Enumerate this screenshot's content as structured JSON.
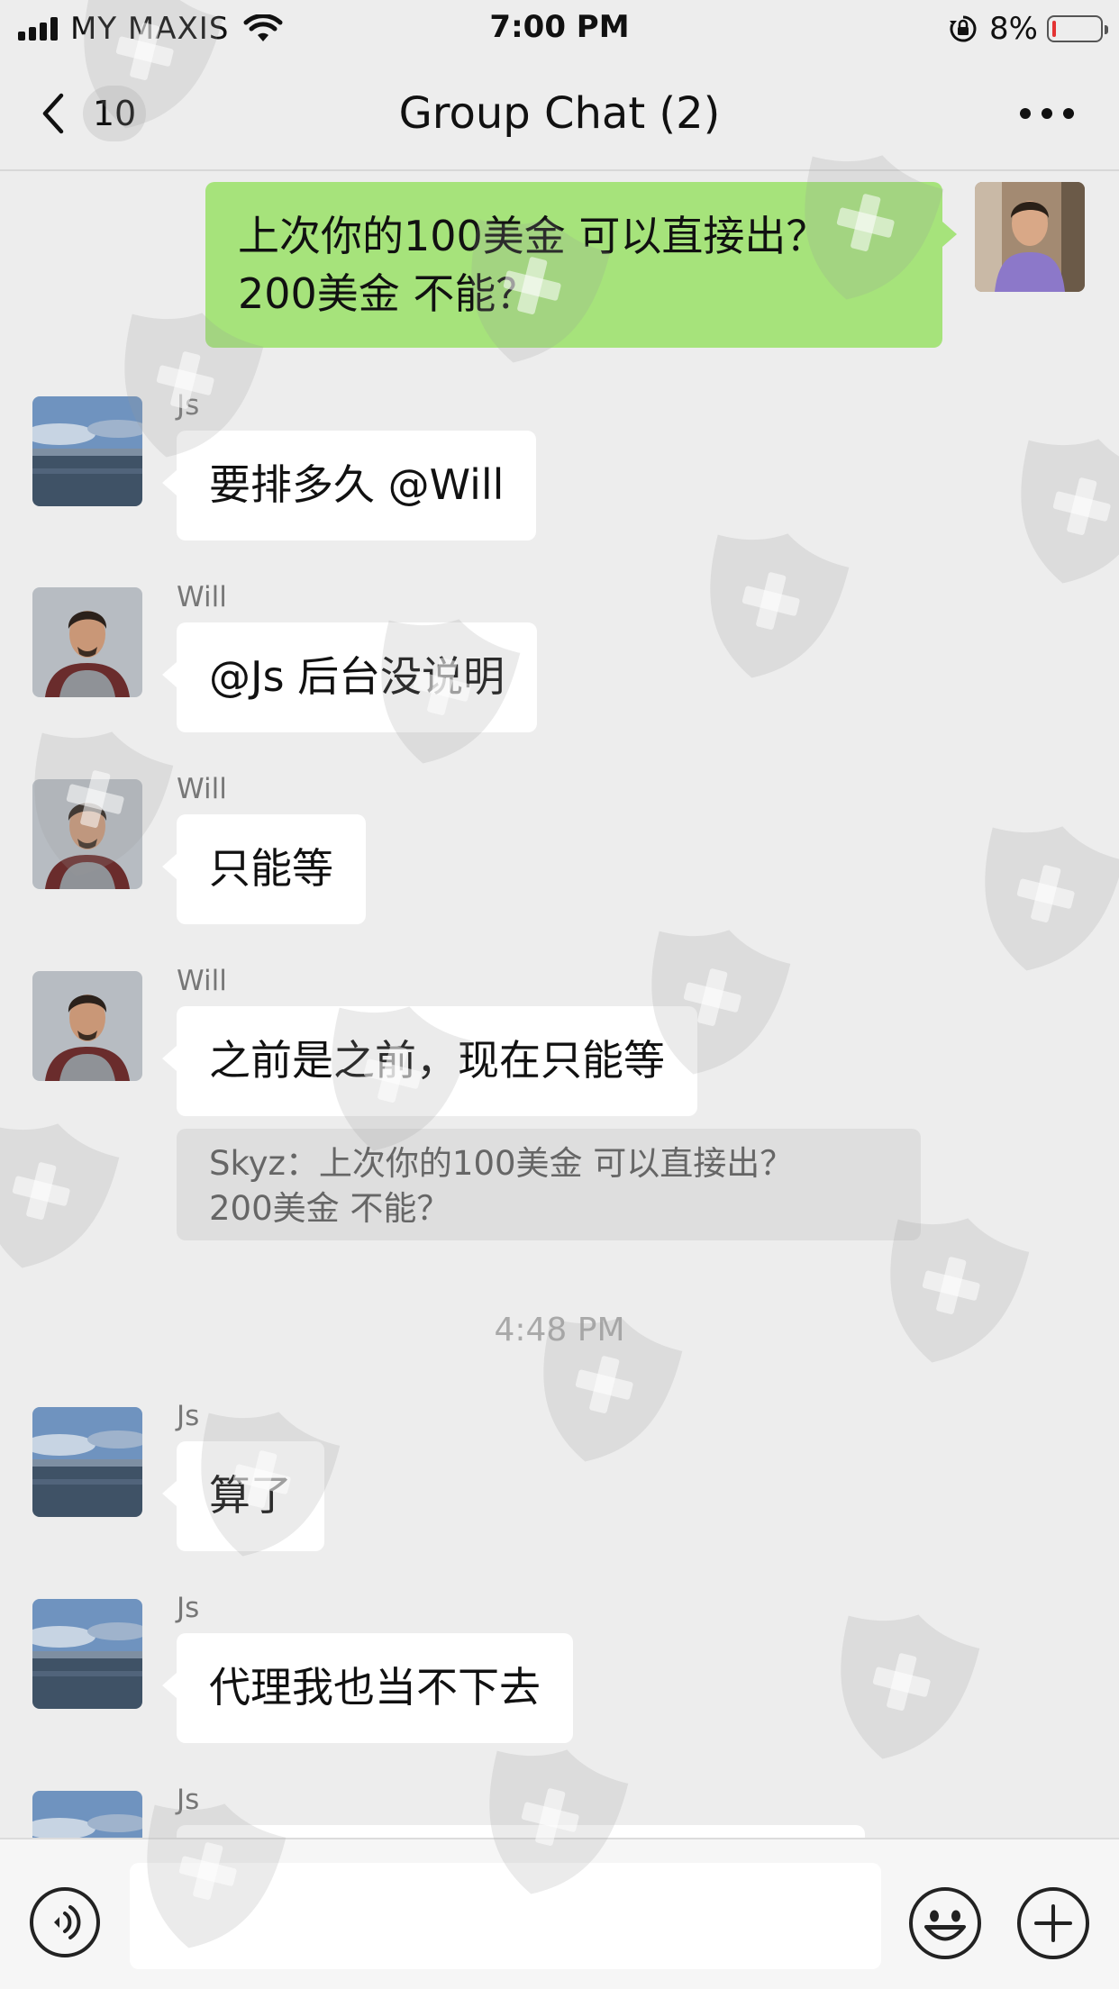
{
  "status_bar": {
    "carrier": "MY MAXIS",
    "time": "7:00 PM",
    "battery_percent": "8%",
    "battery_level": 0.08,
    "icons": [
      "signal-icon",
      "wifi-icon",
      "rotation-lock-icon",
      "battery-icon"
    ]
  },
  "nav": {
    "back_count": "10",
    "title": "Group Chat (2)",
    "icons": [
      "chevron-left-icon",
      "more-icon"
    ]
  },
  "messages": [
    {
      "sender": "",
      "text_lines": [
        "上次你的100美金 可以直接出？",
        "200美金 不能？"
      ],
      "mine": true
    },
    {
      "sender": "Js",
      "text": "要排多久 @Will"
    },
    {
      "sender": "Will",
      "text": "@Js 后台没说明"
    },
    {
      "sender": "Will",
      "text": "只能等"
    },
    {
      "sender": "Will",
      "text": "之前是之前，现在只能等"
    }
  ],
  "quote": {
    "line1": "Skyz：上次你的100美金 可以直接出？",
    "line2": "200美金 不能？"
  },
  "time_divider": "4:48 PM",
  "messages_after": [
    {
      "sender": "Js",
      "text": "算了"
    },
    {
      "sender": "Js",
      "text": "代理我也当不下去"
    },
    {
      "sender": "Js",
      "text": ""
    }
  ],
  "input_bar": {
    "placeholder": "",
    "icons": [
      "voice-icon",
      "emoji-icon",
      "plus-icon"
    ]
  },
  "colors": {
    "background": "#ededed",
    "my_bubble": "#a6e37b",
    "other_bubble": "#ffffff",
    "battery_low": "#e33333"
  }
}
